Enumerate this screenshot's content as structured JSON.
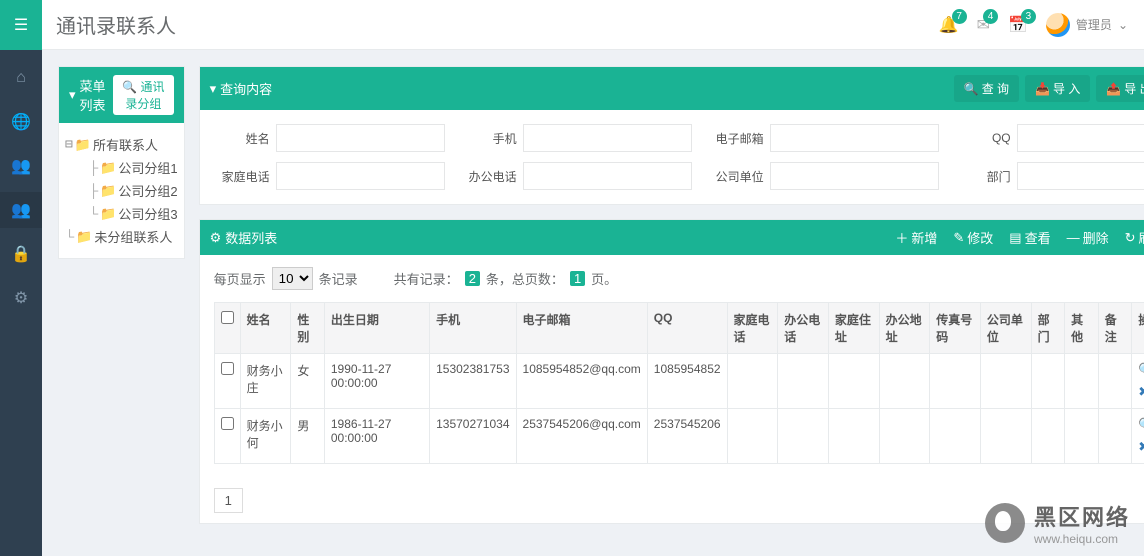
{
  "header": {
    "title": "通讯录联系人",
    "notifications": [
      {
        "icon": "bell",
        "count": 7
      },
      {
        "icon": "envelope",
        "count": 4
      },
      {
        "icon": "calendar",
        "count": 3
      }
    ],
    "user": {
      "name": "管理员"
    }
  },
  "sidebar_nav": [
    {
      "icon": "home"
    },
    {
      "icon": "globe"
    },
    {
      "icon": "users-light"
    },
    {
      "icon": "users",
      "active": true
    },
    {
      "icon": "lock"
    },
    {
      "icon": "cog"
    }
  ],
  "tree": {
    "title": "菜单列表",
    "button": "通讯录分组",
    "nodes": [
      {
        "label": "所有联系人",
        "level": 0,
        "toggle": "⊟"
      },
      {
        "label": "公司分组1",
        "level": 1
      },
      {
        "label": "公司分组2",
        "level": 1
      },
      {
        "label": "公司分组3",
        "level": 1
      },
      {
        "label": "未分组联系人",
        "level": 0
      }
    ]
  },
  "filter": {
    "title": "查询内容",
    "actions": {
      "search": "查 询",
      "import": "导 入",
      "export": "导 出"
    },
    "fields": {
      "name": "姓名",
      "mobile": "手机",
      "email": "电子邮箱",
      "qq": "QQ",
      "home_phone": "家庭电话",
      "office_phone": "办公电话",
      "company": "公司单位",
      "dept": "部门"
    }
  },
  "grid": {
    "title": "数据列表",
    "toolbar": {
      "add": "新增",
      "edit": "修改",
      "view": "查看",
      "delete": "删除",
      "refresh": "刷新"
    },
    "pager": {
      "per_page_prefix": "每页显示",
      "per_page_value": "10",
      "per_page_suffix": "条记录",
      "total_prefix": "共有记录：",
      "total_records": "2",
      "total_mid": "条，总页数：",
      "total_pages": "1",
      "total_suffix": "页。"
    },
    "columns": [
      "",
      "姓名",
      "性别",
      "出生日期",
      "手机",
      "电子邮箱",
      "QQ",
      "家庭电话",
      "办公电话",
      "家庭住址",
      "办公地址",
      "传真号码",
      "公司单位",
      "部门",
      "其他",
      "备注",
      "操作"
    ],
    "rows": [
      {
        "name": "财务小庄",
        "gender": "女",
        "birth": "1990-11-27 00:00:00",
        "mobile": "15302381753",
        "email": "1085954852@qq.com",
        "qq": "1085954852"
      },
      {
        "name": "财务小何",
        "gender": "男",
        "birth": "1986-11-27 00:00:00",
        "mobile": "13570271034",
        "email": "2537545206@qq.com",
        "qq": "2537545206"
      }
    ],
    "current_page": "1"
  },
  "watermark": {
    "cn": "黑区网络",
    "url": "www.heiqu.com"
  }
}
